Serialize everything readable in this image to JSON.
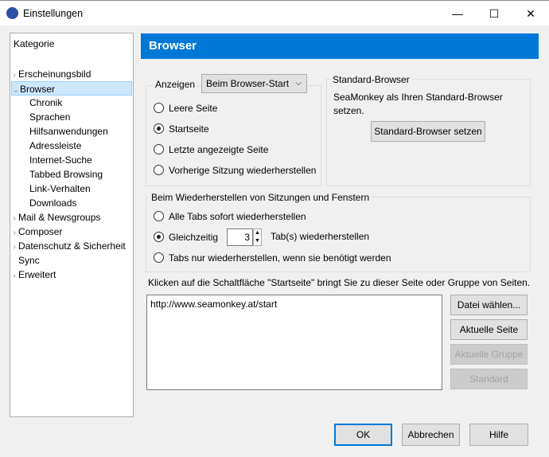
{
  "window": {
    "title": "Einstellungen",
    "minimize": "—",
    "maximize": "☐",
    "close": "✕"
  },
  "sidebar": {
    "heading": "Kategorie",
    "items": [
      {
        "label": "Erscheinungsbild",
        "level": 0,
        "chevron": ">"
      },
      {
        "label": "Browser",
        "level": 0,
        "chevron": "v",
        "selected": true
      },
      {
        "label": "Chronik",
        "level": 1
      },
      {
        "label": "Sprachen",
        "level": 1
      },
      {
        "label": "Hilfsanwendungen",
        "level": 1
      },
      {
        "label": "Adressleiste",
        "level": 1
      },
      {
        "label": "Internet-Suche",
        "level": 1
      },
      {
        "label": "Tabbed Browsing",
        "level": 1
      },
      {
        "label": "Link-Verhalten",
        "level": 1
      },
      {
        "label": "Downloads",
        "level": 1
      },
      {
        "label": "Mail & Newsgroups",
        "level": 0,
        "chevron": ">"
      },
      {
        "label": "Composer",
        "level": 0,
        "chevron": ">"
      },
      {
        "label": "Datenschutz & Sicherheit",
        "level": 0,
        "chevron": ">"
      },
      {
        "label": "Sync",
        "level": 0,
        "chevron": ""
      },
      {
        "label": "Erweitert",
        "level": 0,
        "chevron": ">"
      }
    ]
  },
  "header": {
    "title": "Browser"
  },
  "startup": {
    "label": "Anzeigen",
    "select_value": "Beim Browser-Start",
    "options": [
      {
        "label": "Leere Seite",
        "checked": false
      },
      {
        "label": "Startseite",
        "checked": true
      },
      {
        "label": "Letzte angezeigte Seite",
        "checked": false
      },
      {
        "label": "Vorherige Sitzung wiederherstellen",
        "checked": false
      }
    ]
  },
  "default_browser": {
    "legend": "Standard-Browser",
    "text": "SeaMonkey als Ihren Standard-Browser setzen.",
    "button": "Standard-Browser setzen"
  },
  "restore": {
    "legend": "Beim Wiederherstellen von Sitzungen und Fenstern",
    "opt1": "Alle Tabs sofort wiederherstellen",
    "opt2_prefix": "Gleichzeitig",
    "opt2_value": "3",
    "opt2_suffix": "Tab(s) wiederherstellen",
    "opt3": "Tabs nur wiederherstellen, wenn sie benötigt werden",
    "selected": 2
  },
  "homepage": {
    "label": "Klicken auf die Schaltfläche \"Startseite\" bringt Sie zu dieser Seite oder Gruppe von Seiten.",
    "value": "http://www.seamonkey.at/start",
    "buttons": {
      "choose_file": "Datei wählen...",
      "current_page": "Aktuelle Seite",
      "current_group": "Aktuelle Gruppe",
      "default": "Standard"
    }
  },
  "footer": {
    "ok": "OK",
    "cancel": "Abbrechen",
    "help": "Hilfe"
  }
}
